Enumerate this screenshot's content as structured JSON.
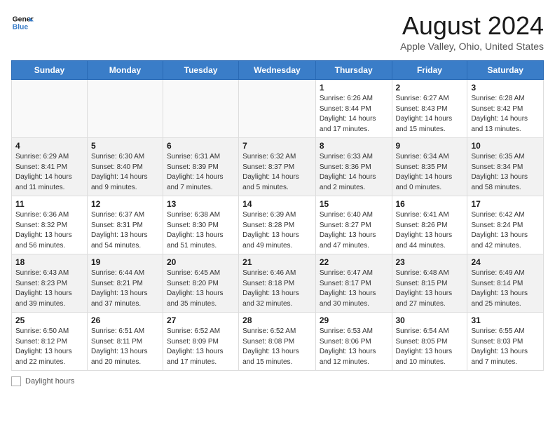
{
  "header": {
    "logo_line1": "General",
    "logo_line2": "Blue",
    "month_title": "August 2024",
    "location": "Apple Valley, Ohio, United States"
  },
  "days_of_week": [
    "Sunday",
    "Monday",
    "Tuesday",
    "Wednesday",
    "Thursday",
    "Friday",
    "Saturday"
  ],
  "weeks": [
    [
      {
        "date": "",
        "info": ""
      },
      {
        "date": "",
        "info": ""
      },
      {
        "date": "",
        "info": ""
      },
      {
        "date": "",
        "info": ""
      },
      {
        "date": "1",
        "info": "Sunrise: 6:26 AM\nSunset: 8:44 PM\nDaylight: 14 hours and 17 minutes."
      },
      {
        "date": "2",
        "info": "Sunrise: 6:27 AM\nSunset: 8:43 PM\nDaylight: 14 hours and 15 minutes."
      },
      {
        "date": "3",
        "info": "Sunrise: 6:28 AM\nSunset: 8:42 PM\nDaylight: 14 hours and 13 minutes."
      }
    ],
    [
      {
        "date": "4",
        "info": "Sunrise: 6:29 AM\nSunset: 8:41 PM\nDaylight: 14 hours and 11 minutes."
      },
      {
        "date": "5",
        "info": "Sunrise: 6:30 AM\nSunset: 8:40 PM\nDaylight: 14 hours and 9 minutes."
      },
      {
        "date": "6",
        "info": "Sunrise: 6:31 AM\nSunset: 8:39 PM\nDaylight: 14 hours and 7 minutes."
      },
      {
        "date": "7",
        "info": "Sunrise: 6:32 AM\nSunset: 8:37 PM\nDaylight: 14 hours and 5 minutes."
      },
      {
        "date": "8",
        "info": "Sunrise: 6:33 AM\nSunset: 8:36 PM\nDaylight: 14 hours and 2 minutes."
      },
      {
        "date": "9",
        "info": "Sunrise: 6:34 AM\nSunset: 8:35 PM\nDaylight: 14 hours and 0 minutes."
      },
      {
        "date": "10",
        "info": "Sunrise: 6:35 AM\nSunset: 8:34 PM\nDaylight: 13 hours and 58 minutes."
      }
    ],
    [
      {
        "date": "11",
        "info": "Sunrise: 6:36 AM\nSunset: 8:32 PM\nDaylight: 13 hours and 56 minutes."
      },
      {
        "date": "12",
        "info": "Sunrise: 6:37 AM\nSunset: 8:31 PM\nDaylight: 13 hours and 54 minutes."
      },
      {
        "date": "13",
        "info": "Sunrise: 6:38 AM\nSunset: 8:30 PM\nDaylight: 13 hours and 51 minutes."
      },
      {
        "date": "14",
        "info": "Sunrise: 6:39 AM\nSunset: 8:28 PM\nDaylight: 13 hours and 49 minutes."
      },
      {
        "date": "15",
        "info": "Sunrise: 6:40 AM\nSunset: 8:27 PM\nDaylight: 13 hours and 47 minutes."
      },
      {
        "date": "16",
        "info": "Sunrise: 6:41 AM\nSunset: 8:26 PM\nDaylight: 13 hours and 44 minutes."
      },
      {
        "date": "17",
        "info": "Sunrise: 6:42 AM\nSunset: 8:24 PM\nDaylight: 13 hours and 42 minutes."
      }
    ],
    [
      {
        "date": "18",
        "info": "Sunrise: 6:43 AM\nSunset: 8:23 PM\nDaylight: 13 hours and 39 minutes."
      },
      {
        "date": "19",
        "info": "Sunrise: 6:44 AM\nSunset: 8:21 PM\nDaylight: 13 hours and 37 minutes."
      },
      {
        "date": "20",
        "info": "Sunrise: 6:45 AM\nSunset: 8:20 PM\nDaylight: 13 hours and 35 minutes."
      },
      {
        "date": "21",
        "info": "Sunrise: 6:46 AM\nSunset: 8:18 PM\nDaylight: 13 hours and 32 minutes."
      },
      {
        "date": "22",
        "info": "Sunrise: 6:47 AM\nSunset: 8:17 PM\nDaylight: 13 hours and 30 minutes."
      },
      {
        "date": "23",
        "info": "Sunrise: 6:48 AM\nSunset: 8:15 PM\nDaylight: 13 hours and 27 minutes."
      },
      {
        "date": "24",
        "info": "Sunrise: 6:49 AM\nSunset: 8:14 PM\nDaylight: 13 hours and 25 minutes."
      }
    ],
    [
      {
        "date": "25",
        "info": "Sunrise: 6:50 AM\nSunset: 8:12 PM\nDaylight: 13 hours and 22 minutes."
      },
      {
        "date": "26",
        "info": "Sunrise: 6:51 AM\nSunset: 8:11 PM\nDaylight: 13 hours and 20 minutes."
      },
      {
        "date": "27",
        "info": "Sunrise: 6:52 AM\nSunset: 8:09 PM\nDaylight: 13 hours and 17 minutes."
      },
      {
        "date": "28",
        "info": "Sunrise: 6:52 AM\nSunset: 8:08 PM\nDaylight: 13 hours and 15 minutes."
      },
      {
        "date": "29",
        "info": "Sunrise: 6:53 AM\nSunset: 8:06 PM\nDaylight: 13 hours and 12 minutes."
      },
      {
        "date": "30",
        "info": "Sunrise: 6:54 AM\nSunset: 8:05 PM\nDaylight: 13 hours and 10 minutes."
      },
      {
        "date": "31",
        "info": "Sunrise: 6:55 AM\nSunset: 8:03 PM\nDaylight: 13 hours and 7 minutes."
      }
    ]
  ],
  "footer": {
    "daylight_label": "Daylight hours"
  }
}
